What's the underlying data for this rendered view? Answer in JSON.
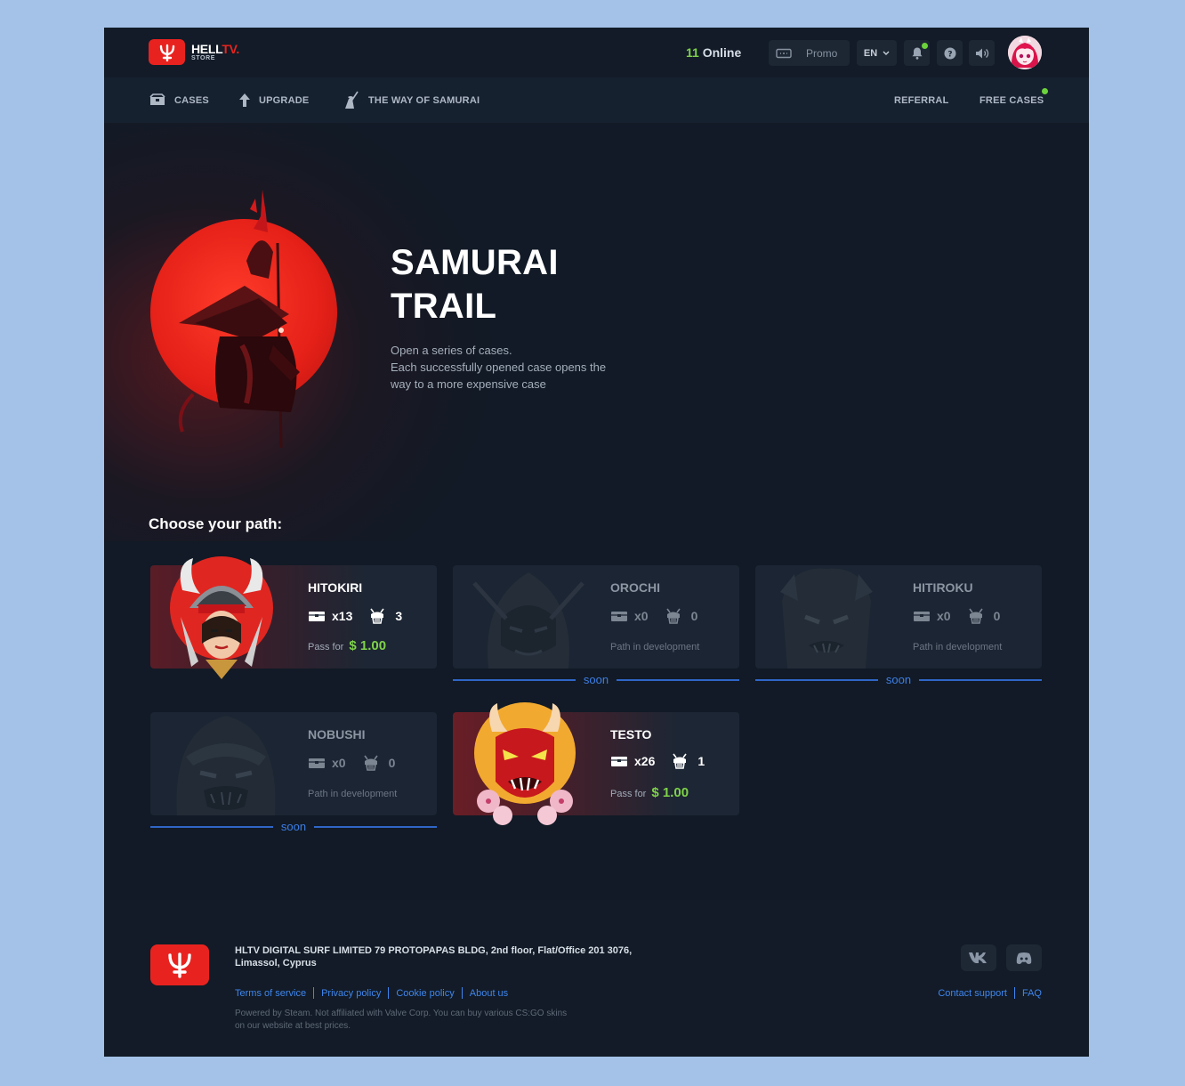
{
  "brand": {
    "name_main": "HELL",
    "name_accent": "TV.",
    "name_sub": "STORE"
  },
  "header": {
    "online_count": "11",
    "online_label": "Online",
    "promo_label": "Promo",
    "language": "EN"
  },
  "nav": {
    "cases": "CASES",
    "upgrade": "UPGRADE",
    "samurai": "THE WAY OF SAMURAI",
    "referral": "REFERRAL",
    "free_cases": "FREE CASES"
  },
  "hero": {
    "title_line1": "SAMURAI",
    "title_line2": "TRAIL",
    "desc_line1": "Open a series of cases.",
    "desc_line2": "Each successfully opened case opens the",
    "desc_line3": "way to a more expensive case"
  },
  "paths_heading": "Choose your path:",
  "paths": [
    {
      "name": "HITOKIRI",
      "cases": "x13",
      "samurai": "3",
      "pass_label": "Pass for",
      "price": "$ 1.00",
      "status": "active"
    },
    {
      "name": "OROCHI",
      "cases": "x0",
      "samurai": "0",
      "dev_label": "Path in development",
      "soon": "soon",
      "status": "soon"
    },
    {
      "name": "HITIROKU",
      "cases": "x0",
      "samurai": "0",
      "dev_label": "Path in development",
      "soon": "soon",
      "status": "soon"
    },
    {
      "name": "NOBUSHI",
      "cases": "x0",
      "samurai": "0",
      "dev_label": "Path in development",
      "soon": "soon",
      "status": "soon"
    },
    {
      "name": "TESTO",
      "cases": "x26",
      "samurai": "1",
      "pass_label": "Pass for",
      "price": "$ 1.00",
      "status": "active"
    }
  ],
  "footer": {
    "address_line1": "HLTV DIGITAL SURF LIMITED 79 PROTOPAPAS BLDG, 2nd floor, Flat/Office 201 3076,",
    "address_line2": "Limassol, Cyprus",
    "links": [
      "Terms of service",
      "Privacy policy",
      "Cookie policy",
      "About us"
    ],
    "right_links": [
      "Contact support",
      "FAQ"
    ],
    "note_line1": "Powered by Steam. Not affiliated with Valve Corp. You can buy various CS:GO skins",
    "note_line2": "on our website at best prices."
  },
  "colors": {
    "accent": "#e8231f",
    "price": "#7fd24a",
    "link": "#3f86ee",
    "soon": "#3e7ee6",
    "background": "#111a26"
  }
}
